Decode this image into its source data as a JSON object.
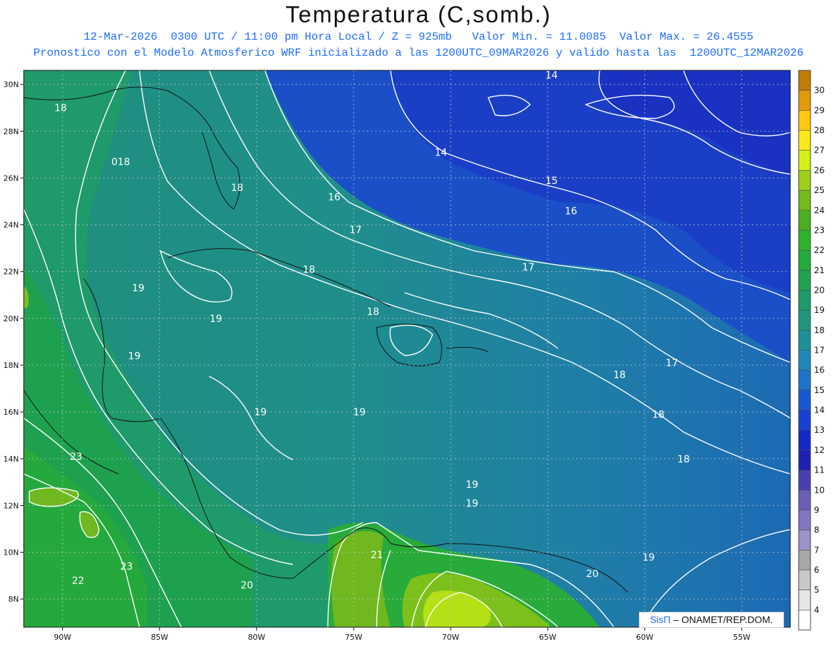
{
  "title": "Temperatura (C,somb.)",
  "subtitle_line1": "12-Mar-2026  0300 UTC / 11:00 pm Hora Local / Z = 925mb   Valor Min. = 11.0085  Valor Max. = 26.4555",
  "subtitle_line2": "Pronostico con el Modelo Atmosferico WRF inicializado a las 1200UTC_09MAR2026 y valido hasta las  1200UTC_12MAR2026",
  "map": {
    "lon_range": [
      -92,
      -52.5
    ],
    "lat_range": [
      6.8,
      30.6
    ],
    "x_ticks": [
      {
        "value": -90,
        "label": "90W"
      },
      {
        "value": -85,
        "label": "85W"
      },
      {
        "value": -80,
        "label": "80W"
      },
      {
        "value": -75,
        "label": "75W"
      },
      {
        "value": -70,
        "label": "70W"
      },
      {
        "value": -65,
        "label": "65W"
      },
      {
        "value": -60,
        "label": "60W"
      },
      {
        "value": -55,
        "label": "55W"
      }
    ],
    "y_ticks": [
      {
        "value": 30,
        "label": "30N"
      },
      {
        "value": 28,
        "label": "28N"
      },
      {
        "value": 26,
        "label": "26N"
      },
      {
        "value": 24,
        "label": "24N"
      },
      {
        "value": 22,
        "label": "22N"
      },
      {
        "value": 20,
        "label": "20N"
      },
      {
        "value": 18,
        "label": "18N"
      },
      {
        "value": 16,
        "label": "16N"
      },
      {
        "value": 14,
        "label": "14N"
      },
      {
        "value": 12,
        "label": "12N"
      },
      {
        "value": 10,
        "label": "10N"
      },
      {
        "value": 8,
        "label": "8N"
      }
    ],
    "grid": true,
    "contour_labels": [
      {
        "text": "14",
        "lon": -64.8,
        "lat": 30.4
      },
      {
        "text": "18",
        "lon": -90.1,
        "lat": 29.0
      },
      {
        "text": "14",
        "lon": -70.5,
        "lat": 27.1
      },
      {
        "text": "018",
        "lon": -87.0,
        "lat": 26.7
      },
      {
        "text": "15",
        "lon": -64.8,
        "lat": 25.9
      },
      {
        "text": "18",
        "lon": -81.0,
        "lat": 25.6
      },
      {
        "text": "16",
        "lon": -76.0,
        "lat": 25.2
      },
      {
        "text": "16",
        "lon": -63.8,
        "lat": 24.6
      },
      {
        "text": "17",
        "lon": -74.9,
        "lat": 23.8
      },
      {
        "text": "17",
        "lon": -66.0,
        "lat": 22.2
      },
      {
        "text": "18",
        "lon": -77.3,
        "lat": 22.1
      },
      {
        "text": "19",
        "lon": -86.1,
        "lat": 21.3
      },
      {
        "text": "18",
        "lon": -74.0,
        "lat": 20.3
      },
      {
        "text": "19",
        "lon": -82.1,
        "lat": 20.0
      },
      {
        "text": "19",
        "lon": -86.3,
        "lat": 18.4
      },
      {
        "text": "17",
        "lon": -58.6,
        "lat": 18.1
      },
      {
        "text": "18",
        "lon": -61.3,
        "lat": 17.6
      },
      {
        "text": "19",
        "lon": -79.8,
        "lat": 16.0
      },
      {
        "text": "19",
        "lon": -74.7,
        "lat": 16.0
      },
      {
        "text": "18",
        "lon": -59.3,
        "lat": 15.9
      },
      {
        "text": "23",
        "lon": -89.3,
        "lat": 14.1
      },
      {
        "text": "18",
        "lon": -58.0,
        "lat": 14.0
      },
      {
        "text": "19",
        "lon": -68.9,
        "lat": 12.9
      },
      {
        "text": "19",
        "lon": -68.9,
        "lat": 12.1
      },
      {
        "text": "21",
        "lon": -73.8,
        "lat": 9.9
      },
      {
        "text": "19",
        "lon": -59.8,
        "lat": 9.8
      },
      {
        "text": "23",
        "lon": -86.7,
        "lat": 9.4
      },
      {
        "text": "20",
        "lon": -62.7,
        "lat": 9.1
      },
      {
        "text": "22",
        "lon": -89.2,
        "lat": 8.8
      },
      {
        "text": "20",
        "lon": -80.5,
        "lat": 8.6
      }
    ]
  },
  "colorbar": {
    "levels": [
      "4",
      "5",
      "6",
      "7",
      "8",
      "9",
      "10",
      "11",
      "12",
      "13",
      "14",
      "15",
      "16",
      "17",
      "18",
      "19",
      "20",
      "21",
      "22",
      "23",
      "24",
      "25",
      "26",
      "27",
      "28",
      "29",
      "30"
    ],
    "colors": [
      "#ffffff",
      "#e6e6e6",
      "#c8c8c8",
      "#a8a8a8",
      "#9b93c9",
      "#8277bf",
      "#6a5fb5",
      "#4a3fb0",
      "#2020b4",
      "#1428c8",
      "#1640d4",
      "#1a58d2",
      "#1e74cc",
      "#2088b8",
      "#1f8f9a",
      "#1f9680",
      "#1e9b68",
      "#1ea450",
      "#22ac3c",
      "#2fb42e",
      "#4cae22",
      "#72bc1e",
      "#9ed01a",
      "#d4f018",
      "#ffe81a",
      "#ffc80e",
      "#e49a08",
      "#c47a06"
    ]
  },
  "credit": {
    "brand": "SisΠ",
    "text": " – ONAMET/REP.DOM."
  }
}
